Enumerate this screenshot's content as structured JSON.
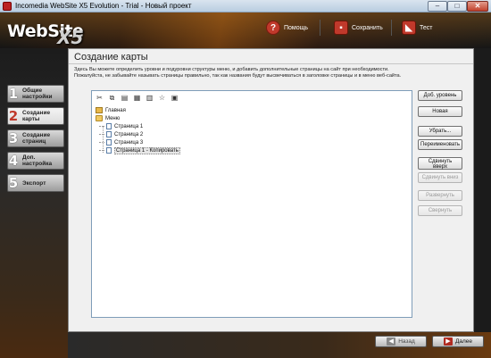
{
  "window": {
    "title": "Incomedia WebSite X5 Evolution - Trial - Новый проект",
    "minimize_glyph": "–",
    "maximize_glyph": "□",
    "close_glyph": "✕"
  },
  "header": {
    "logo_text": "WebSite",
    "logo_suffix": "X5",
    "buttons": [
      {
        "label": "Помощь",
        "icon": "help-icon",
        "glyph": "?"
      },
      {
        "label": "Сохранить",
        "icon": "save-icon",
        "glyph": "▪"
      },
      {
        "label": "Тест",
        "icon": "test-icon",
        "glyph": "◣"
      }
    ]
  },
  "nav": {
    "items": [
      {
        "num": "1",
        "line1": "Общие",
        "line2": "настройки",
        "active": false
      },
      {
        "num": "2",
        "line1": "Создание",
        "line2": "карты",
        "active": true
      },
      {
        "num": "3",
        "line1": "Создание",
        "line2": "страниц",
        "active": false
      },
      {
        "num": "4",
        "line1": "Доп.",
        "line2": "настройка",
        "active": false
      },
      {
        "num": "5",
        "line1": "Экспорт",
        "line2": "",
        "active": false
      }
    ]
  },
  "main": {
    "title": "Создание карты",
    "desc_line1": "Здесь Вы можете определить уровни и подуровни структуры меню, и добавить дополнительные страницы на сайт при необходимости.",
    "desc_line2": "Пожалуйста, не забывайте называть страницы правильно, так как названия будут высвечиваться в заголовке страницы и в меню веб-сайта."
  },
  "toolbar": {
    "icons": [
      {
        "name": "cut-icon",
        "glyph": "✂"
      },
      {
        "name": "copy-icon",
        "glyph": "⧉"
      },
      {
        "name": "paste-icon",
        "glyph": "▤"
      },
      {
        "name": "import-icon",
        "glyph": "▦"
      },
      {
        "name": "export-icon",
        "glyph": "▥"
      },
      {
        "name": "star-icon",
        "glyph": "☆"
      },
      {
        "name": "properties-icon",
        "glyph": "▣"
      }
    ]
  },
  "tree": {
    "home": "Главная",
    "menu": "Меню",
    "pages": [
      "Страница 1",
      "Страница 2",
      "Страница 3",
      "Страница 1 - Копировать"
    ]
  },
  "buttons": {
    "add_level": "Доб. уровень",
    "new": "Новая",
    "remove": "Убрать...",
    "rename": "Переименовать",
    "move_up_1": "Сдвинуть",
    "move_up_2": "вверх",
    "move_down": "Сдвинуть вниз",
    "expand": "Развернуть",
    "collapse": "Свернуть"
  },
  "footer": {
    "back": "Назад",
    "next": "Далее",
    "back_arrow": "◀",
    "next_arrow": "▶"
  }
}
